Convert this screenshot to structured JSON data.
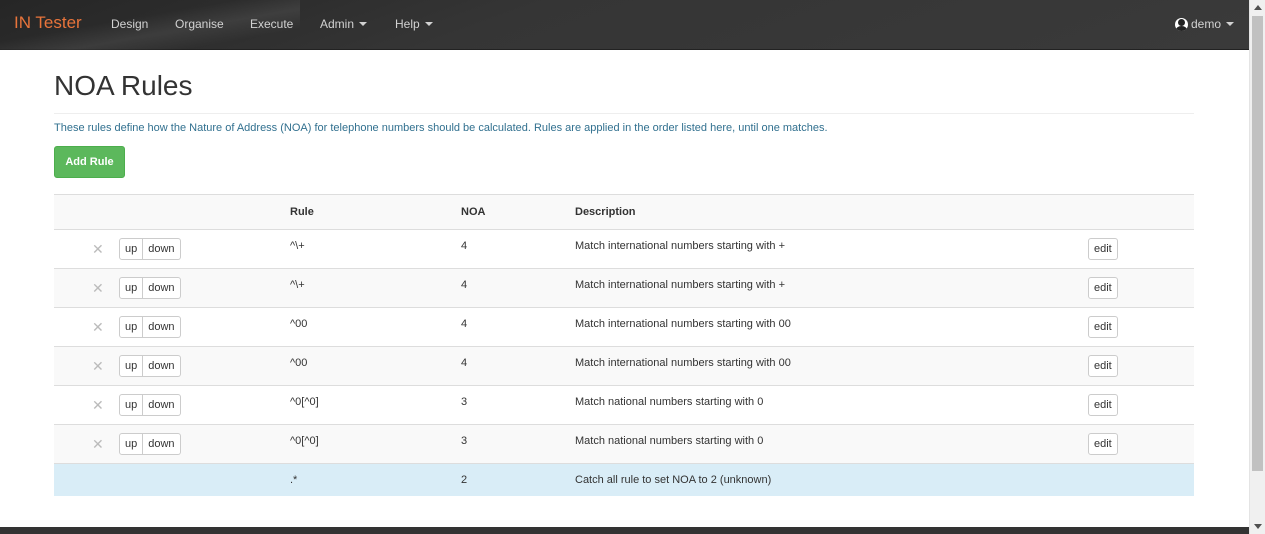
{
  "navbar": {
    "brand": "IN Tester",
    "items": [
      {
        "label": "Design",
        "dropdown": false
      },
      {
        "label": "Organise",
        "dropdown": false
      },
      {
        "label": "Execute",
        "dropdown": false
      },
      {
        "label": "Admin",
        "dropdown": true
      },
      {
        "label": "Help",
        "dropdown": true
      }
    ],
    "user": "demo",
    "brand_color": "#e8743b"
  },
  "page": {
    "title": "NOA Rules",
    "intro": "These rules define how the Nature of Address (NOA) for telephone numbers should be calculated. Rules are applied in the order listed here, until one matches.",
    "add_button": "Add Rule"
  },
  "table": {
    "headers": {
      "rule": "Rule",
      "noa": "NOA",
      "description": "Description"
    },
    "row_actions": {
      "up": "up",
      "down": "down",
      "edit": "edit",
      "delete_icon": "times-icon"
    },
    "rows": [
      {
        "rule": "^\\+",
        "noa": "4",
        "description": "Match international numbers starting with +"
      },
      {
        "rule": "^\\+",
        "noa": "4",
        "description": "Match international numbers starting with +"
      },
      {
        "rule": "^00",
        "noa": "4",
        "description": "Match international numbers starting with 00"
      },
      {
        "rule": "^00",
        "noa": "4",
        "description": "Match international numbers starting with 00"
      },
      {
        "rule": "^0[^0]",
        "noa": "3",
        "description": "Match national numbers starting with 0"
      },
      {
        "rule": "^0[^0]",
        "noa": "3",
        "description": "Match national numbers starting with 0"
      }
    ],
    "catch_all": {
      "rule": ".*",
      "noa": "2",
      "description": "Catch all rule to set NOA to 2 (unknown)"
    }
  },
  "colors": {
    "success": "#5cb85c",
    "info_row": "#d9edf7",
    "info_text": "#31708f"
  }
}
